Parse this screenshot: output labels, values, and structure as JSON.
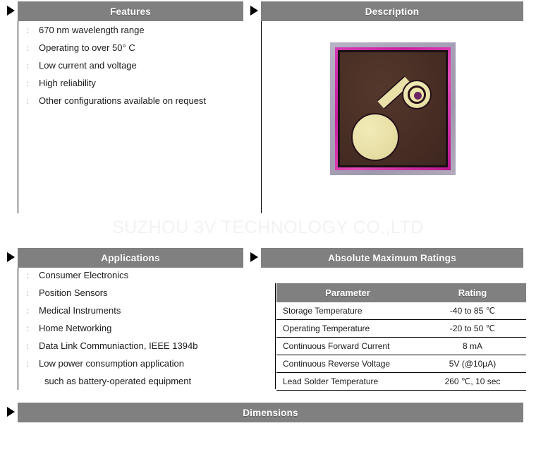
{
  "watermark": "SUZHOU 3V TECHNOLOGY CO.,LTD",
  "theme": {
    "bar_bg": "#808080",
    "bar_text": "#ffffff",
    "body_text": "#1a1a1a",
    "bullet": "#c9c9c9",
    "rule": "#000000",
    "watermark_color": "#f2f2f2"
  },
  "sections": {
    "features": {
      "title": "Features",
      "marker": "triangle-right-icon",
      "items": [
        "670 nm wavelength range",
        "Operating to over 50° C",
        "Low current and voltage",
        "High  reliability",
        "Other configurations available on request"
      ]
    },
    "description": {
      "title": "Description",
      "marker": "triangle-right-icon",
      "image_name": "photodiode-die-photo"
    },
    "applications": {
      "title": "Applications",
      "marker": "triangle-right-icon",
      "items": [
        "Consumer Electronics",
        "Position Sensors",
        "Medical Instruments",
        "Home Networking",
        "Data Link Communiaction, IEEE 1394b",
        "Low power consumption application"
      ],
      "continuation": "such as battery-operated equipment"
    },
    "ratings": {
      "title": "Absolute Maximum Ratings",
      "marker": "triangle-right-icon",
      "columns": [
        "Parameter",
        "Rating"
      ],
      "rows": [
        {
          "parameter": "Storage Temperature",
          "rating": "-40 to 85 ℃"
        },
        {
          "parameter": "Operating Temperature",
          "rating": "-20 to 50 ℃"
        },
        {
          "parameter": "Continuous Forward Current",
          "rating": "8 mA"
        },
        {
          "parameter": "Continuous Reverse Voltage",
          "rating": "5V (@10μA)"
        },
        {
          "parameter": "Lead Solder Temperature",
          "rating": "260 ℃, 10 sec"
        }
      ]
    },
    "dimensions": {
      "title": "Dimensions",
      "marker": "triangle-right-icon"
    }
  }
}
